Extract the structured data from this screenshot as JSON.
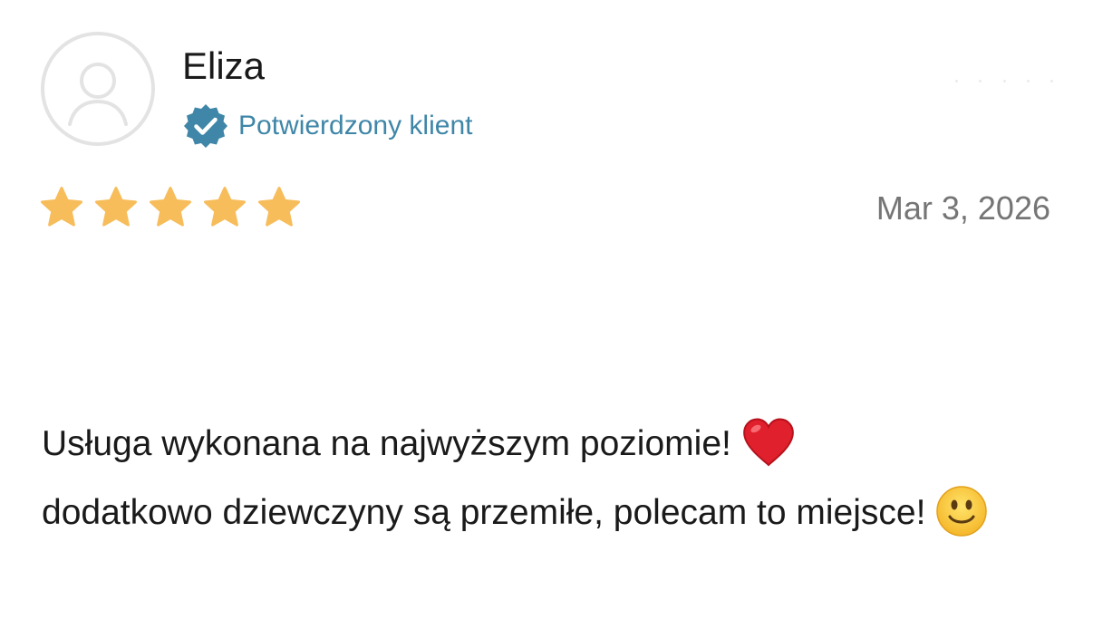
{
  "reviewer": {
    "name": "Eliza",
    "avatar_icon": "user-placeholder-icon",
    "verified_icon": "verified-check-badge-icon",
    "verified_label": "Potwierdzony klient"
  },
  "rating": {
    "stars": 5,
    "max_stars": 5,
    "star_icon": "star-icon",
    "star_color": "#f7bd5b"
  },
  "review": {
    "date": "Mar 3, 2026",
    "text_part1": "Usługa wykonana na najwyższym poziomie!",
    "text_part2": "dodatkowo dziewczyny są przemiłe, polecam to miejsce!",
    "emoji_1": "heart-emoji",
    "emoji_2": "slightly-smiling-face-emoji"
  },
  "colors": {
    "verified_accent": "#3f86a8",
    "date_text": "#757575",
    "body_text": "#1a1a1a",
    "avatar_border": "#e3e3e3"
  }
}
